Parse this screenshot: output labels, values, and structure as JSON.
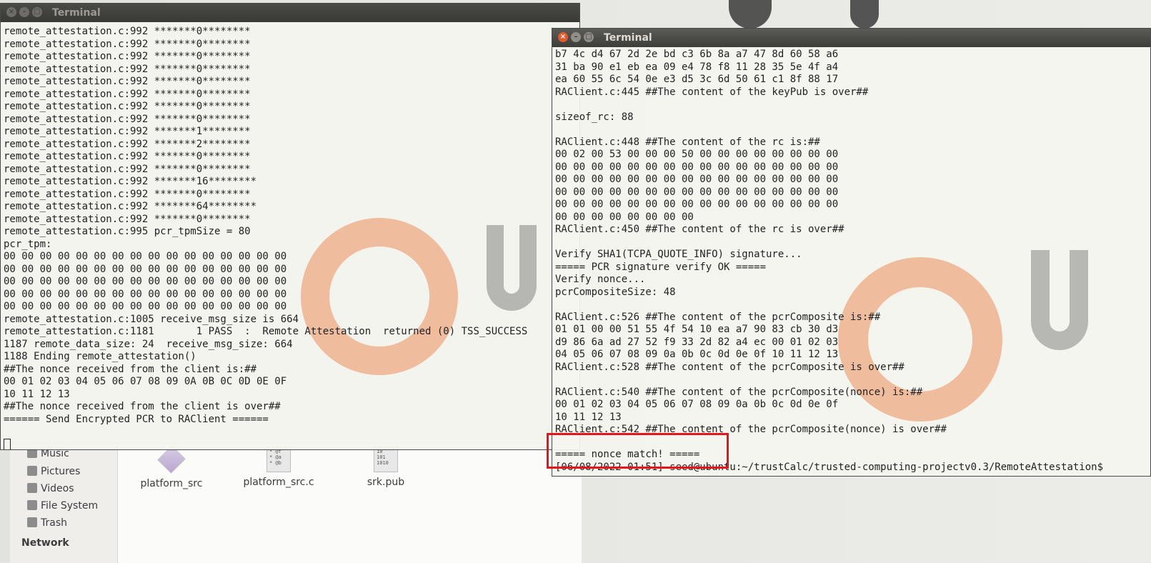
{
  "terminal_left": {
    "title": "Terminal",
    "lines": [
      "remote_attestation.c:992 *******0********",
      "remote_attestation.c:992 *******0********",
      "remote_attestation.c:992 *******0********",
      "remote_attestation.c:992 *******0********",
      "remote_attestation.c:992 *******0********",
      "remote_attestation.c:992 *******0********",
      "remote_attestation.c:992 *******0********",
      "remote_attestation.c:992 *******0********",
      "remote_attestation.c:992 *******1********",
      "remote_attestation.c:992 *******2********",
      "remote_attestation.c:992 *******0********",
      "remote_attestation.c:992 *******0********",
      "remote_attestation.c:992 *******16********",
      "remote_attestation.c:992 *******0********",
      "remote_attestation.c:992 *******64********",
      "remote_attestation.c:992 *******0********",
      "remote_attestation.c:995 pcr_tpmSize = 80",
      "pcr_tpm:",
      "00 00 00 00 00 00 00 00 00 00 00 00 00 00 00 00",
      "00 00 00 00 00 00 00 00 00 00 00 00 00 00 00 00",
      "00 00 00 00 00 00 00 00 00 00 00 00 00 00 00 00",
      "00 00 00 00 00 00 00 00 00 00 00 00 00 00 00 00",
      "00 00 00 00 00 00 00 00 00 00 00 00 00 00 00 00",
      "remote_attestation.c:1005 receive_msg_size is 664",
      "remote_attestation.c:1181       1 PASS  :  Remote Attestation  returned (0) TSS_SUCCESS",
      "1187 remote_data_size: 24  receive_msg_size: 664",
      "1188 Ending remote_attestation()",
      "##The nonce received from the client is:##",
      "00 01 02 03 04 05 06 07 08 09 0A 0B 0C 0D 0E 0F",
      "10 11 12 13",
      "##The nonce received from the client is over##",
      "====== Send Encrypted PCR to RAClient ======"
    ]
  },
  "terminal_right": {
    "title": "Terminal",
    "lines": [
      "b7 4c d4 67 2d 2e bd c3 6b 8a a7 47 8d 60 58 a6",
      "31 ba 90 e1 eb ea 09 e4 78 f8 11 28 35 5e 4f a4",
      "ea 60 55 6c 54 0e e3 d5 3c 6d 50 61 c1 8f 88 17",
      "RAClient.c:445 ##The content of the keyPub is over##",
      "",
      "sizeof_rc: 88",
      "",
      "RAClient.c:448 ##The content of the rc is:##",
      "00 02 00 53 00 00 00 50 00 00 00 00 00 00 00 00",
      "00 00 00 00 00 00 00 00 00 00 00 00 00 00 00 00",
      "00 00 00 00 00 00 00 00 00 00 00 00 00 00 00 00",
      "00 00 00 00 00 00 00 00 00 00 00 00 00 00 00 00",
      "00 00 00 00 00 00 00 00 00 00 00 00 00 00 00 00",
      "00 00 00 00 00 00 00 00",
      "RAClient.c:450 ##The content of the rc is over##",
      "",
      "Verify SHA1(TCPA_QUOTE_INFO) signature...",
      "===== PCR signature verify OK =====",
      "Verify nonce...",
      "pcrCompositeSize: 48",
      "",
      "RAClient.c:526 ##The content of the pcrComposite is:##",
      "01 01 00 00 51 55 4f 54 10 ea a7 90 83 cb 30 d3",
      "d9 86 6a ad 27 52 f9 33 2d 82 a4 ec 00 01 02 03",
      "04 05 06 07 08 09 0a 0b 0c 0d 0e 0f 10 11 12 13",
      "RAClient.c:528 ##The content of the pcrComposite is over##",
      "",
      "RAClient.c:540 ##The content of the pcrComposite(nonce) is:##",
      "00 01 02 03 04 05 06 07 08 09 0a 0b 0c 0d 0e 0f",
      "10 11 12 13",
      "RAClient.c:542 ##The content of the pcrComposite(nonce) is over##",
      "",
      "===== nonce match! =====",
      "[06/08/2022 01:51] seed@ubuntu:~/trustCalc/trusted-computing-projectv0.3/RemoteAttestation$"
    ]
  },
  "file_manager": {
    "sidebar": [
      {
        "label": "Music",
        "icon": "music-icon"
      },
      {
        "label": "Pictures",
        "icon": "pictures-icon"
      },
      {
        "label": "Videos",
        "icon": "videos-icon"
      },
      {
        "label": "File System",
        "icon": "drive-icon"
      },
      {
        "label": "Trash",
        "icon": "trash-icon"
      }
    ],
    "section": "Network",
    "files": [
      {
        "name": "platform_src",
        "icon": "executable-icon"
      },
      {
        "name": "platform_src.c",
        "icon": "c-source-icon",
        "preview": "* @f\n* @a\n* @b"
      },
      {
        "name": "srk.pub",
        "icon": "binary-file-icon",
        "preview": "10\n101\n1010"
      }
    ]
  },
  "colors": {
    "highlight": "#e8131b",
    "close_button": "#e05a2b"
  }
}
